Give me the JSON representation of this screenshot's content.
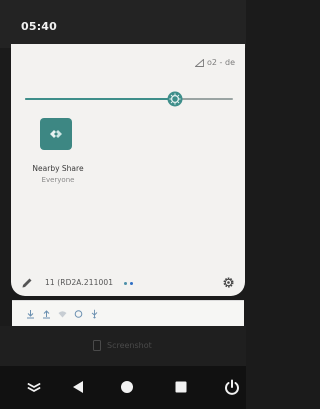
{
  "status_bar": {
    "time": "05:40"
  },
  "quick_settings": {
    "network_label": "o2 - de",
    "brightness_level": 0.72,
    "tile": {
      "label": "Nearby Share",
      "sublabel": "Everyone",
      "icon": "nearby-share-icon"
    },
    "build_number": "11 (RD2A.211001",
    "page_count": 2,
    "active_page": 1
  },
  "notification_icons": [
    "download-icon",
    "upload-icon",
    "wifi-icon",
    "vpn-icon",
    "usb-icon"
  ],
  "screenshot_label": "Screenshot",
  "nav_bar": {
    "buttons": [
      "expand-icon",
      "back-icon",
      "home-icon",
      "recents-icon",
      "power-icon"
    ]
  },
  "colors": {
    "accent": "#3d8783",
    "panel": "#f3f2f0",
    "background": "#1b1b1b"
  }
}
